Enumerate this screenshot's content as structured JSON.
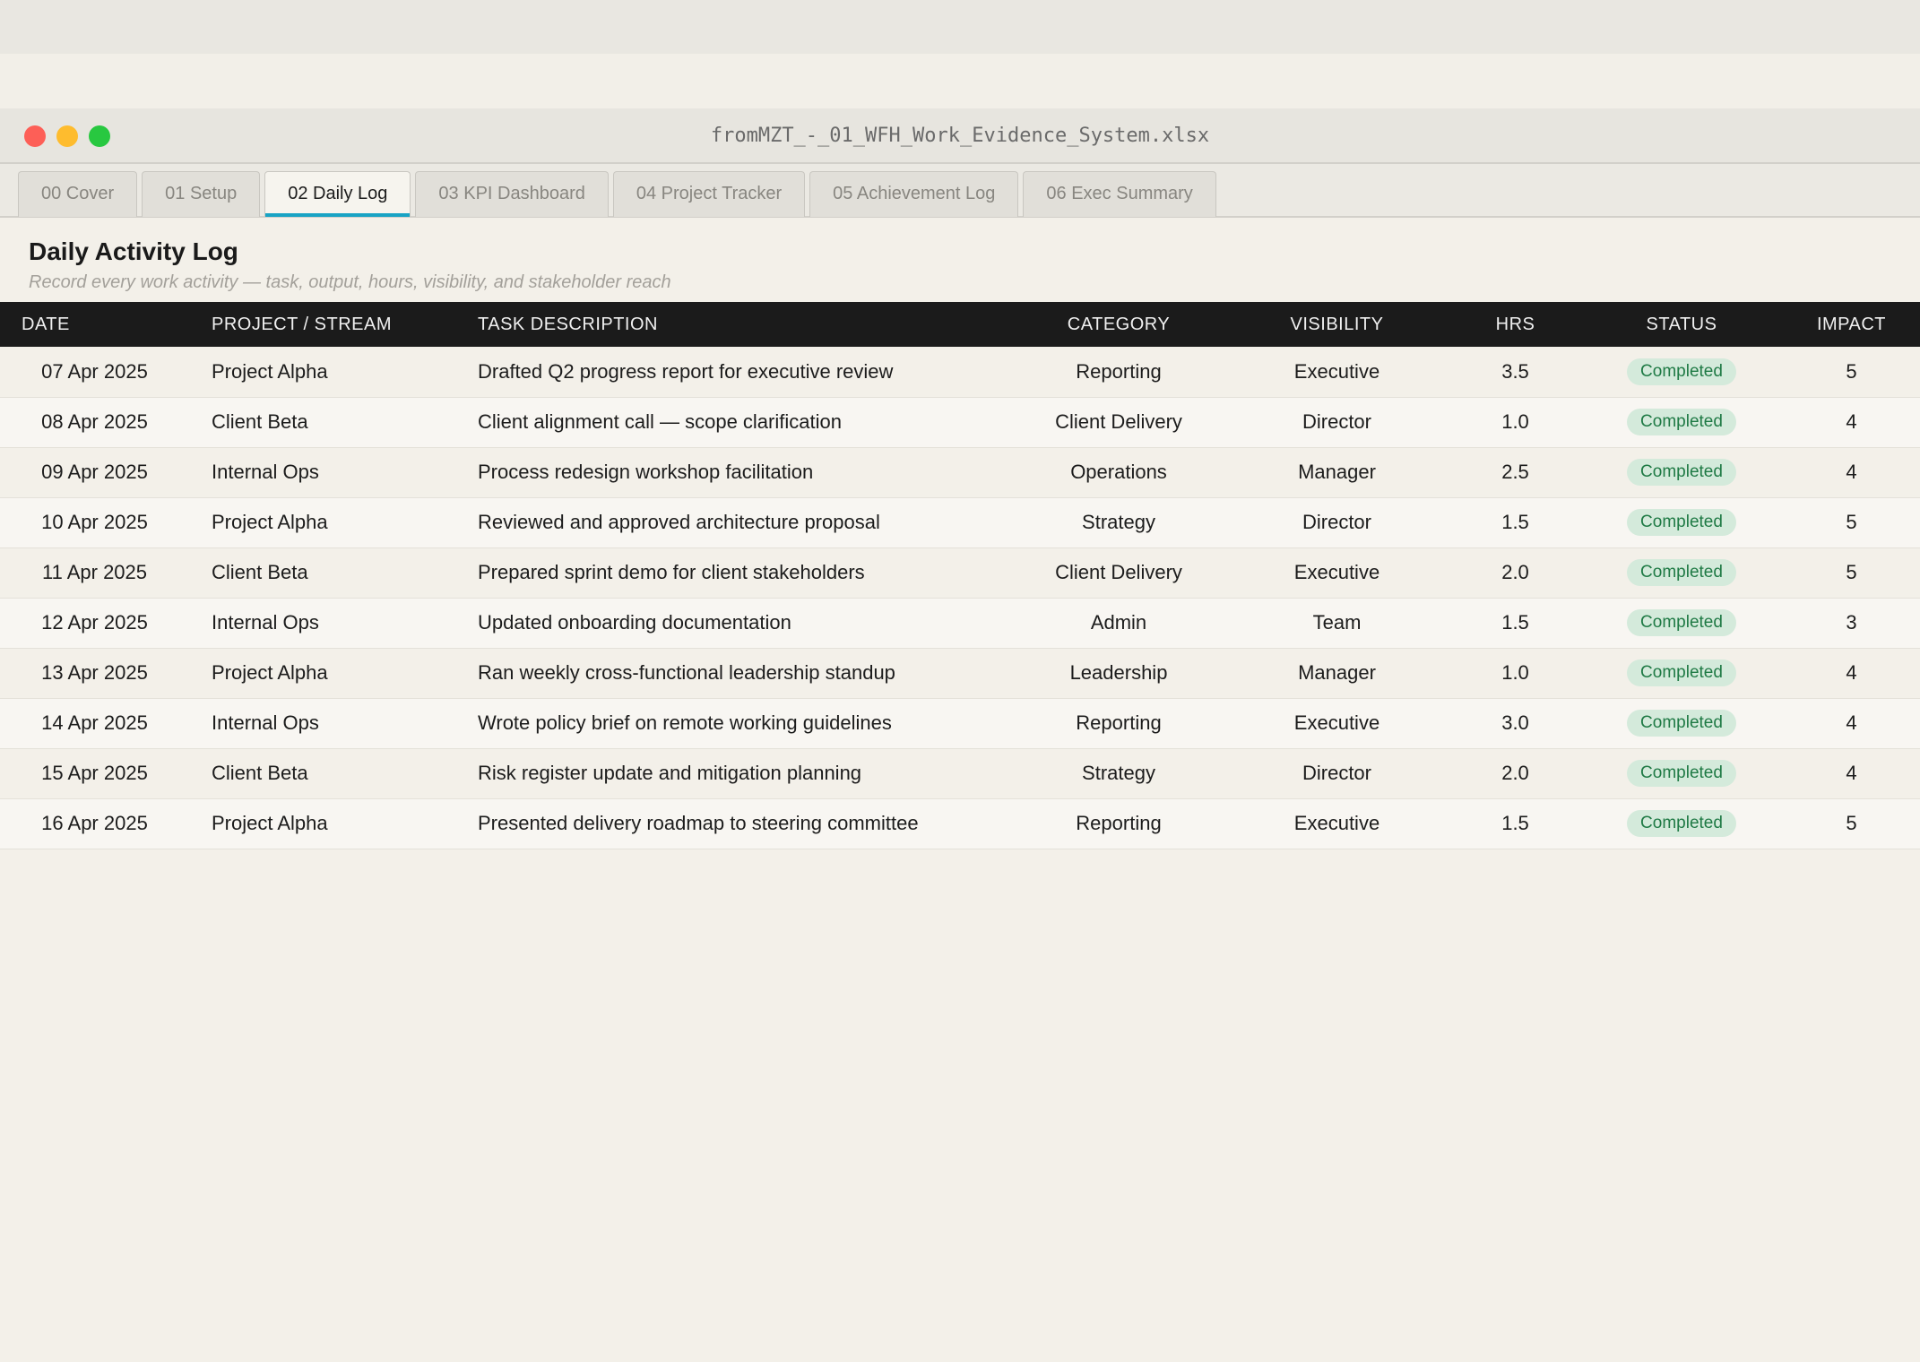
{
  "window": {
    "title": "fromMZT_-_01_WFH_Work_Evidence_System.xlsx"
  },
  "tabs": [
    {
      "label": "00 Cover"
    },
    {
      "label": "01 Setup"
    },
    {
      "label": "02 Daily Log"
    },
    {
      "label": "03 KPI Dashboard"
    },
    {
      "label": "04 Project Tracker"
    },
    {
      "label": "05 Achievement Log"
    },
    {
      "label": "06 Exec Summary"
    }
  ],
  "sheet": {
    "title": "Daily Activity Log",
    "subtitle": "Record every work activity — task, output, hours, visibility, and stakeholder reach"
  },
  "table": {
    "columns": [
      "DATE",
      "PROJECT / STREAM",
      "TASK DESCRIPTION",
      "CATEGORY",
      "VISIBILITY",
      "HRS",
      "STATUS",
      "IMPACT"
    ],
    "rows": [
      {
        "date": "07 Apr 2025",
        "project": "Project Alpha",
        "task": "Drafted Q2 progress report for executive review",
        "category": "Reporting",
        "visibility": "Executive",
        "hrs": "3.5",
        "status": "Completed",
        "impact": "5"
      },
      {
        "date": "08 Apr 2025",
        "project": "Client Beta",
        "task": "Client alignment call — scope clarification",
        "category": "Client Delivery",
        "visibility": "Director",
        "hrs": "1.0",
        "status": "Completed",
        "impact": "4"
      },
      {
        "date": "09 Apr 2025",
        "project": "Internal Ops",
        "task": "Process redesign workshop facilitation",
        "category": "Operations",
        "visibility": "Manager",
        "hrs": "2.5",
        "status": "Completed",
        "impact": "4"
      },
      {
        "date": "10 Apr 2025",
        "project": "Project Alpha",
        "task": "Reviewed and approved architecture proposal",
        "category": "Strategy",
        "visibility": "Director",
        "hrs": "1.5",
        "status": "Completed",
        "impact": "5"
      },
      {
        "date": "11 Apr 2025",
        "project": "Client Beta",
        "task": "Prepared sprint demo for client stakeholders",
        "category": "Client Delivery",
        "visibility": "Executive",
        "hrs": "2.0",
        "status": "Completed",
        "impact": "5"
      },
      {
        "date": "12 Apr 2025",
        "project": "Internal Ops",
        "task": "Updated onboarding documentation",
        "category": "Admin",
        "visibility": "Team",
        "hrs": "1.5",
        "status": "Completed",
        "impact": "3"
      },
      {
        "date": "13 Apr 2025",
        "project": "Project Alpha",
        "task": "Ran weekly cross-functional leadership standup",
        "category": "Leadership",
        "visibility": "Manager",
        "hrs": "1.0",
        "status": "Completed",
        "impact": "4"
      },
      {
        "date": "14 Apr 2025",
        "project": "Internal Ops",
        "task": "Wrote policy brief on remote working guidelines",
        "category": "Reporting",
        "visibility": "Executive",
        "hrs": "3.0",
        "status": "Completed",
        "impact": "4"
      },
      {
        "date": "15 Apr 2025",
        "project": "Client Beta",
        "task": "Risk register update and mitigation planning",
        "category": "Strategy",
        "visibility": "Director",
        "hrs": "2.0",
        "status": "Completed",
        "impact": "4"
      },
      {
        "date": "16 Apr 2025",
        "project": "Project Alpha",
        "task": "Presented delivery roadmap to steering committee",
        "category": "Reporting",
        "visibility": "Executive",
        "hrs": "1.5",
        "status": "Completed",
        "impact": "5"
      }
    ]
  },
  "colors": {
    "accent": "#18a3c4",
    "header_bg": "#1b1b1b",
    "badge_bg": "#d4eadb",
    "badge_text": "#1f7a45"
  }
}
